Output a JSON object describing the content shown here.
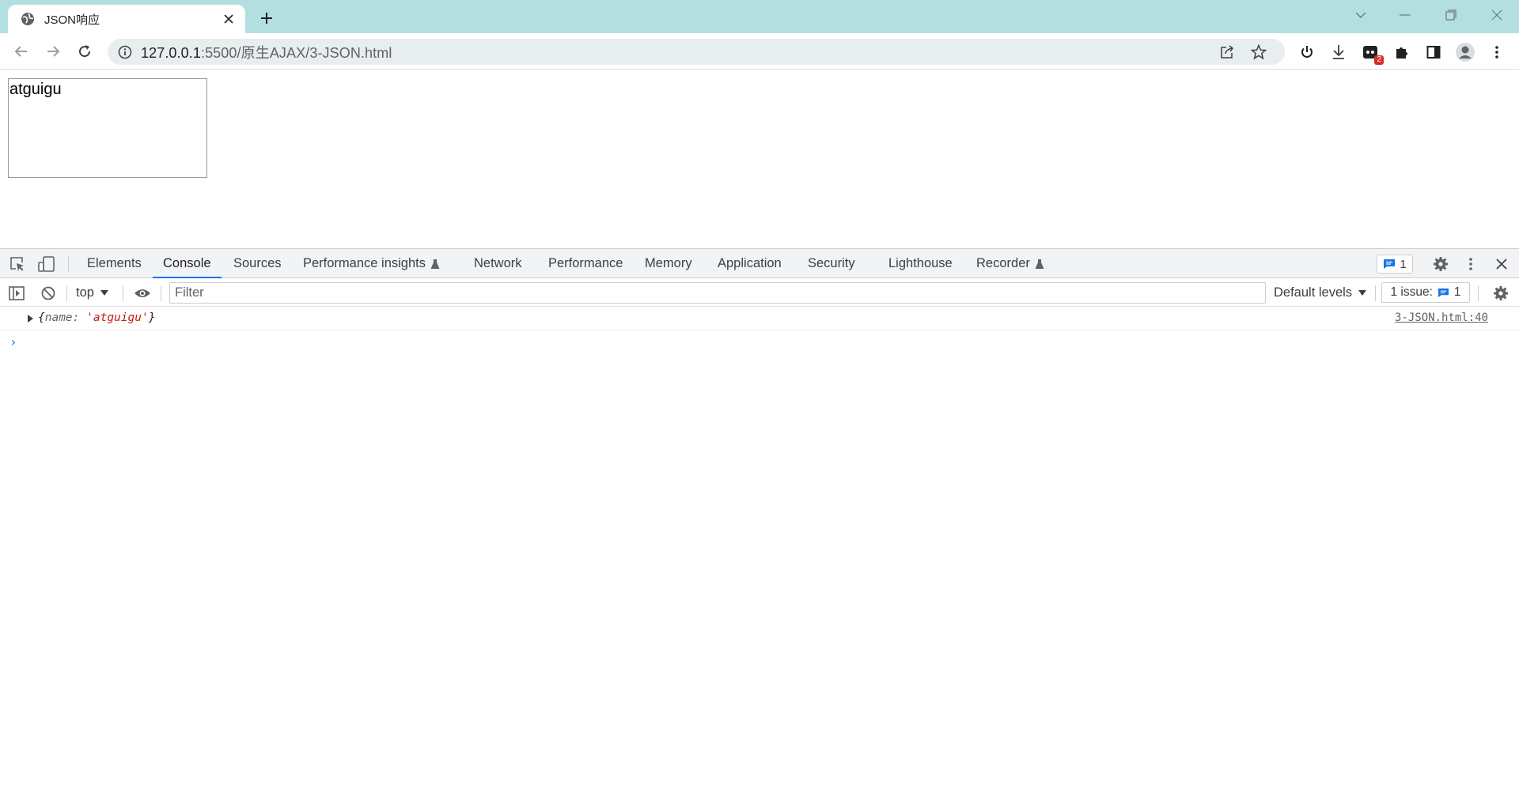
{
  "browser": {
    "tab_title": "JSON响应",
    "url_host": "127.0.0.1",
    "url_path": ":5500/原生AJAX/3-JSON.html",
    "extension_badge": "2"
  },
  "page": {
    "result_text": "atguigu"
  },
  "devtools": {
    "tabs": [
      "Elements",
      "Console",
      "Sources",
      "Performance insights",
      "Network",
      "Performance",
      "Memory",
      "Application",
      "Security",
      "Lighthouse",
      "Recorder"
    ],
    "active_tab": "Console",
    "issues_count": "1",
    "console": {
      "context": "top",
      "filter_placeholder": "Filter",
      "levels": "Default levels",
      "issue_label": "1 issue:",
      "issue_count": "1",
      "message": {
        "open": "{",
        "key": "name",
        "colon": ": ",
        "value": "'atguigu'",
        "close": "}",
        "source": "3-JSON.html:40"
      },
      "prompt": "›"
    }
  },
  "colors": {
    "tabstrip": "#b4dfe0",
    "accent": "#1a73e8",
    "string": "#c41a16",
    "badge": "#d93025"
  }
}
